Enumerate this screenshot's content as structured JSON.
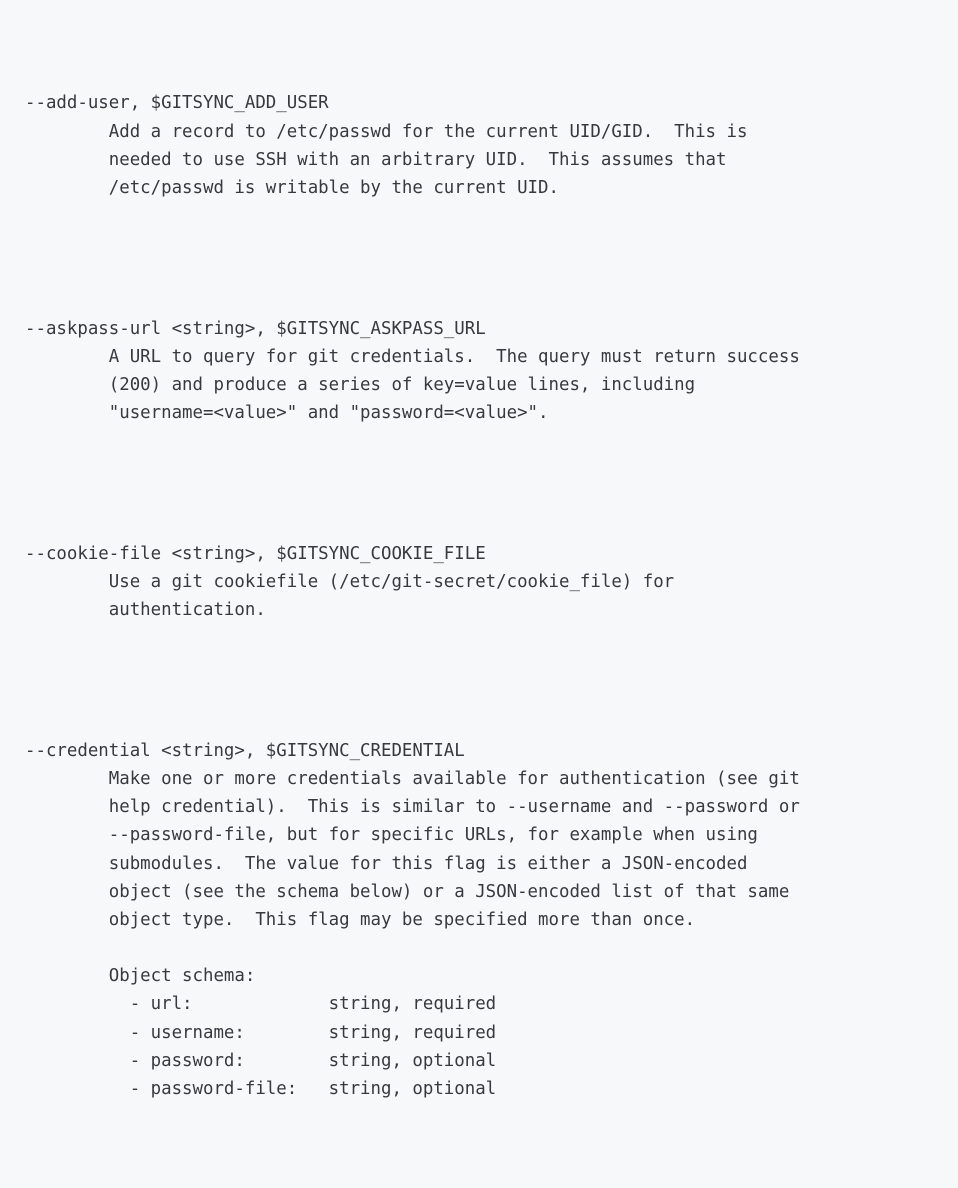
{
  "document": {
    "kind": "cli-help-text",
    "program_context": "gitsync flag reference",
    "background_color": "#f7f8fa",
    "text_color": "#36393e"
  },
  "flags": [
    {
      "signature": "--add-user, $GITSYNC_ADD_USER",
      "name": "--add-user",
      "env_var": "$GITSYNC_ADD_USER",
      "arg_type": "",
      "description_lines": [
        "        Add a record to /etc/passwd for the current UID/GID.  This is",
        "        needed to use SSH with an arbitrary UID.  This assumes that",
        "        /etc/passwd is writable by the current UID."
      ]
    },
    {
      "signature": "--askpass-url <string>, $GITSYNC_ASKPASS_URL",
      "name": "--askpass-url",
      "env_var": "$GITSYNC_ASKPASS_URL",
      "arg_type": "<string>",
      "description_lines": [
        "        A URL to query for git credentials.  The query must return success",
        "        (200) and produce a series of key=value lines, including",
        "        \"username=<value>\" and \"password=<value>\"."
      ]
    },
    {
      "signature": "--cookie-file <string>, $GITSYNC_COOKIE_FILE",
      "name": "--cookie-file",
      "env_var": "$GITSYNC_COOKIE_FILE",
      "arg_type": "<string>",
      "description_lines": [
        "        Use a git cookiefile (/etc/git-secret/cookie_file) for",
        "        authentication."
      ]
    },
    {
      "signature": "--credential <string>, $GITSYNC_CREDENTIAL",
      "name": "--credential",
      "env_var": "$GITSYNC_CREDENTIAL",
      "arg_type": "<string>",
      "description_lines": [
        "        Make one or more credentials available for authentication (see git",
        "        help credential).  This is similar to --username and --password or",
        "        --password-file, but for specific URLs, for example when using",
        "        submodules.  The value for this flag is either a JSON-encoded",
        "        object (see the schema below) or a JSON-encoded list of that same",
        "        object type.  This flag may be specified more than once."
      ],
      "schema": {
        "heading": "        Object schema:",
        "rows": [
          "          - url:             string, required",
          "          - username:        string, required",
          "          - password:        string, optional",
          "          - password-file:   string, optional"
        ],
        "fields": [
          {
            "name": "url",
            "type": "string",
            "requirement": "required"
          },
          {
            "name": "username",
            "type": "string",
            "requirement": "required"
          },
          {
            "name": "password",
            "type": "string",
            "requirement": "optional"
          },
          {
            "name": "password-file",
            "type": "string",
            "requirement": "optional"
          }
        ]
      }
    }
  ]
}
